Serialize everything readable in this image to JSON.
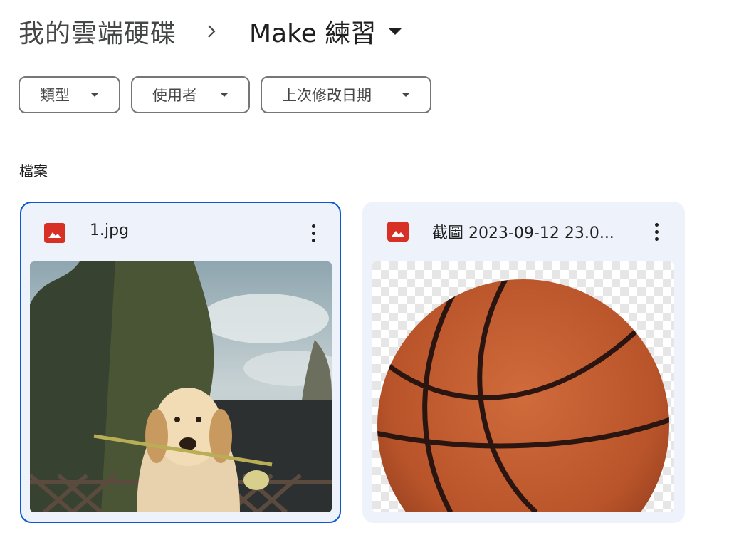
{
  "breadcrumb": {
    "root": "我的雲端硬碟",
    "current": "Make 練習"
  },
  "filters": [
    {
      "label": "類型"
    },
    {
      "label": "使用者"
    },
    {
      "label": "上次修改日期"
    }
  ],
  "section": {
    "title": "檔案"
  },
  "files": [
    {
      "name": "1.jpg",
      "icon": "image-icon",
      "thumbnail": "golden retriever puppy holding a flower"
    },
    {
      "name": "截圖 2023-09-12 23.0...",
      "icon": "image-icon",
      "thumbnail": "basketball on transparent background"
    }
  ],
  "colors": {
    "accent": "#0b57d0",
    "card_bg": "#eef2fa",
    "image_icon": "#d93025"
  }
}
